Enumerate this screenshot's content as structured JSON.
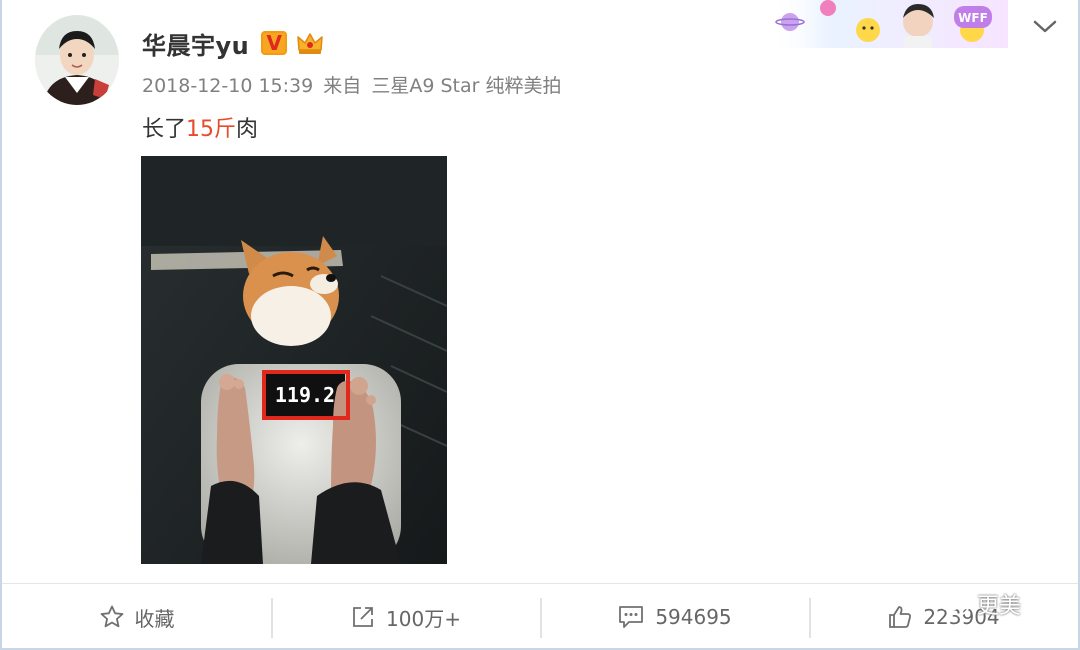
{
  "post": {
    "username": "华晨宇yu",
    "verified_letter": "V",
    "timestamp": "2018-12-10 15:39",
    "source_prefix": "来自",
    "source_device": "三星A9 Star 纯粹美拍",
    "text_before": "长了",
    "text_highlight": "15斤",
    "text_after": "肉",
    "scale_reading": "119.2"
  },
  "banner": {
    "label": "WFF"
  },
  "actions": {
    "favorite_label": "收藏",
    "share_count": "100万+",
    "comment_count": "594695",
    "like_count": "223904"
  },
  "watermark": {
    "label": "更美"
  },
  "colors": {
    "highlight": "#e84b2a",
    "meta_gray": "#808080",
    "verified_orange": "#f6a623",
    "annotation_red": "#e0281d"
  }
}
